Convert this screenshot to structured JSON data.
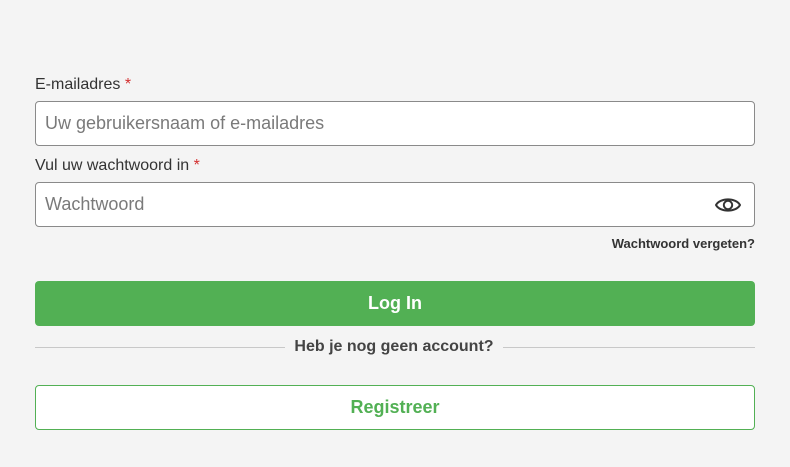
{
  "email": {
    "label": "E-mailadres",
    "required_marker": "*",
    "placeholder": "Uw gebruikersnaam of e-mailadres",
    "value": ""
  },
  "password": {
    "label": "Vul uw wachtwoord in",
    "required_marker": "*",
    "placeholder": "Wachtwoord",
    "value": "",
    "toggle_icon": "eye-icon"
  },
  "forgot_password_link": "Wachtwoord vergeten?",
  "login_button": "Log In",
  "no_account_text": "Heb je nog geen account?",
  "register_button": "Registreer",
  "colors": {
    "primary_green": "#52b054",
    "required_red": "#d32f2f",
    "background": "#f4f4f4"
  }
}
